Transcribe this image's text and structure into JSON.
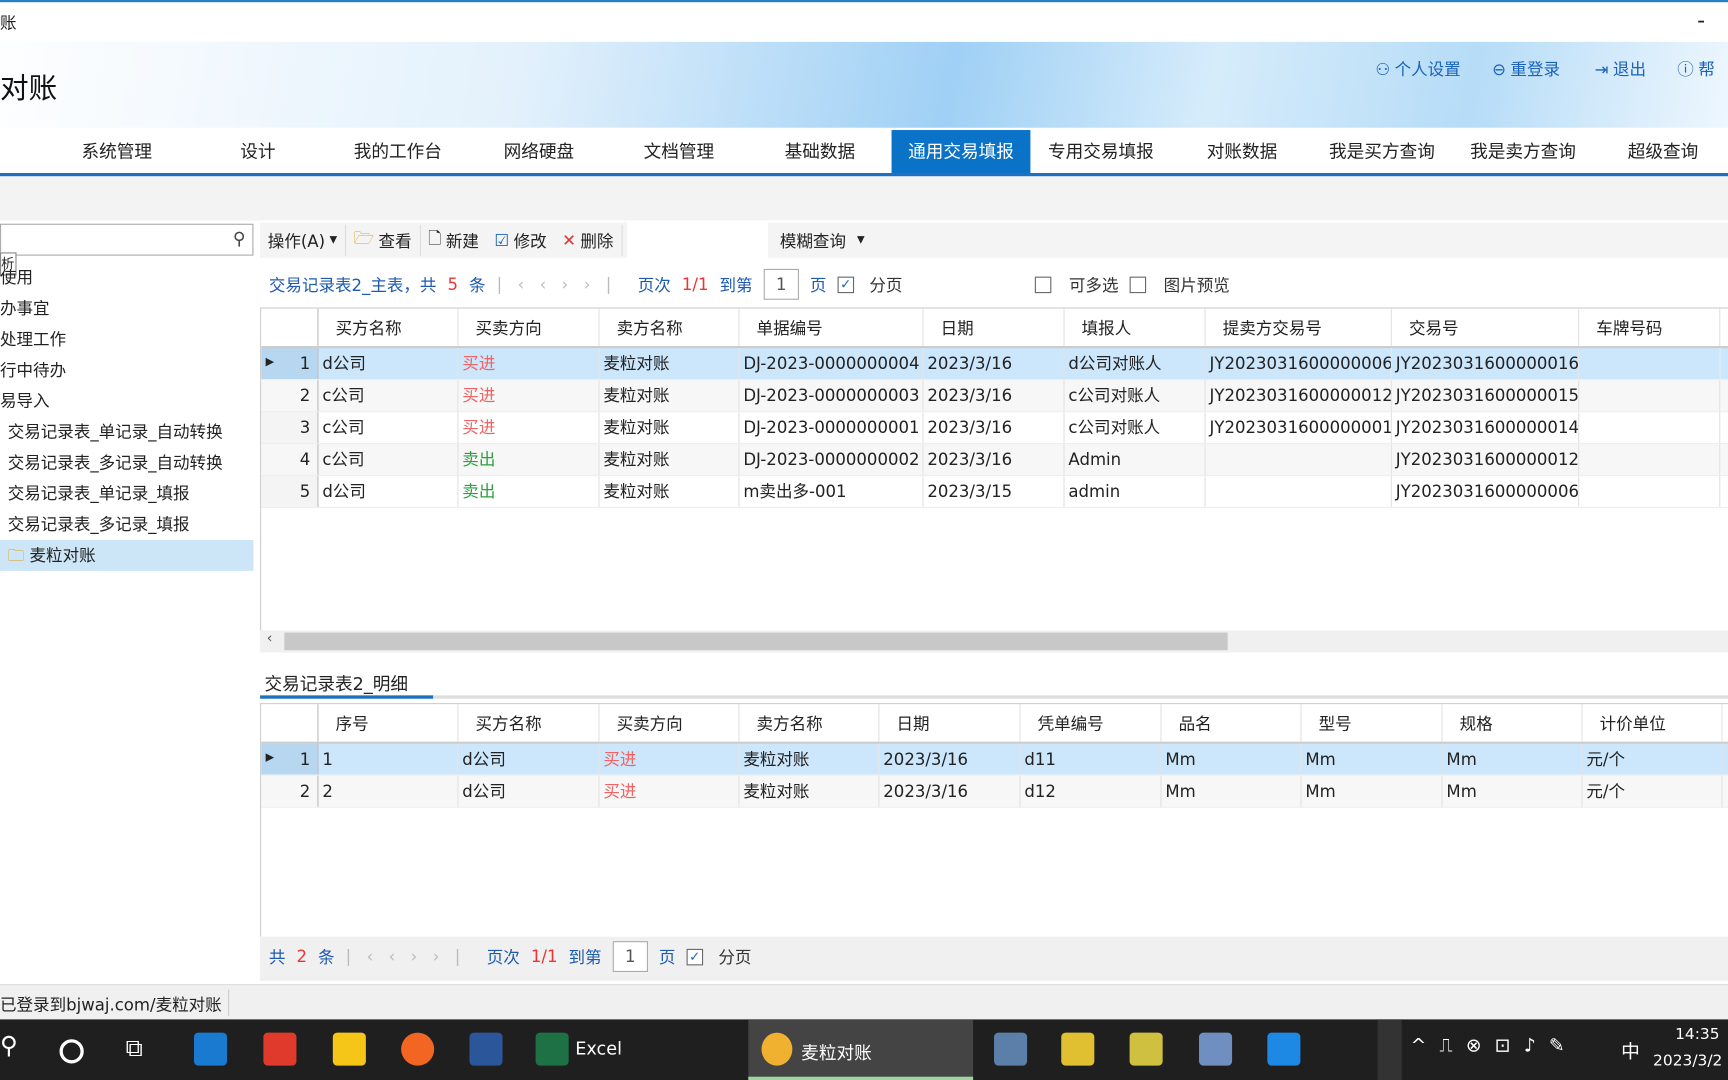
{
  "window": {
    "title": "账",
    "minimize": "-"
  },
  "header": {
    "logo": "对账",
    "links": [
      "个人设置",
      "重登录",
      "退出",
      "帮"
    ]
  },
  "nav": {
    "items": [
      "系统管理",
      "设计",
      "我的工作台",
      "网络硬盘",
      "文档管理",
      "基础数据",
      "通用交易填报",
      "专用交易填报",
      "对账数据",
      "我是买方查询",
      "我是卖方查询",
      "超级查询"
    ],
    "active": "通用交易填报"
  },
  "sidebar": {
    "search_placeholder": "",
    "tooltip": "析",
    "items": [
      "使用",
      "办事宜",
      "处理工作",
      "行中待办",
      "易导入",
      "交易记录表_单记录_自动转换",
      "交易记录表_多记录_自动转换",
      "交易记录表_单记录_填报",
      "交易记录表_多记录_填报",
      "麦粒对账"
    ],
    "selected": "麦粒对账"
  },
  "toolbar": {
    "operate": "操作(A)",
    "view": "查看",
    "new": "新建",
    "edit": "修改",
    "delete": "删除",
    "fuzzy": "模糊查询"
  },
  "master": {
    "pager": {
      "title": "交易记录表2_主表，共",
      "count": "5",
      "unit": "条",
      "page_label": "页次",
      "page": "1/1",
      "goto": "到第",
      "page_input": "1",
      "page_unit": "页",
      "paging": "分页",
      "multi": "可多选",
      "preview": "图片预览"
    },
    "columns": [
      "买方名称",
      "买卖方向",
      "卖方名称",
      "单据编号",
      "日期",
      "填报人",
      "提卖方交易号",
      "交易号",
      "车牌号码"
    ],
    "rows": [
      [
        "d公司",
        "买进",
        "麦粒对账",
        "DJ-2023-0000000004",
        "2023/3/16",
        "d公司对账人",
        "JY2023031600000006",
        "JY2023031600000016",
        ""
      ],
      [
        "c公司",
        "买进",
        "麦粒对账",
        "DJ-2023-0000000003",
        "2023/3/16",
        "c公司对账人",
        "JY2023031600000012",
        "JY2023031600000015",
        ""
      ],
      [
        "c公司",
        "买进",
        "麦粒对账",
        "DJ-2023-0000000001",
        "2023/3/16",
        "c公司对账人",
        "JY2023031600000001",
        "JY2023031600000014",
        ""
      ],
      [
        "c公司",
        "卖出",
        "麦粒对账",
        "DJ-2023-0000000002",
        "2023/3/16",
        "Admin",
        "",
        "JY2023031600000012",
        ""
      ],
      [
        "d公司",
        "卖出",
        "麦粒对账",
        "m卖出多-001",
        "2023/3/15",
        "admin",
        "",
        "JY2023031600000006",
        ""
      ]
    ]
  },
  "detail": {
    "tab": "交易记录表2_明细",
    "columns": [
      "序号",
      "买方名称",
      "买卖方向",
      "卖方名称",
      "日期",
      "凭单编号",
      "品名",
      "型号",
      "规格",
      "计价单位"
    ],
    "rows": [
      [
        "1",
        "d公司",
        "买进",
        "麦粒对账",
        "2023/3/16",
        "d11",
        "Mm",
        "Mm",
        "Mm",
        "元/个"
      ],
      [
        "2",
        "d公司",
        "买进",
        "麦粒对账",
        "2023/3/16",
        "d12",
        "Mm",
        "Mm",
        "Mm",
        "元/个"
      ]
    ],
    "pager": {
      "title": "共",
      "count": "2",
      "unit": "条",
      "page_label": "页次",
      "page": "1/1",
      "goto": "到第",
      "page_input": "1",
      "page_unit": "页",
      "paging": "分页"
    }
  },
  "status": {
    "text": "已登录到bjwaj.com/麦粒对账"
  },
  "taskbar": {
    "excel": "Excel",
    "app": "麦粒对账",
    "time": "14:35",
    "date": "2023/3/2",
    "ime": "中"
  },
  "colors": {
    "accent": "#0a72c7",
    "buy": "#f06464",
    "sell": "#2e9e40",
    "selected_row": "#cce6fb"
  }
}
